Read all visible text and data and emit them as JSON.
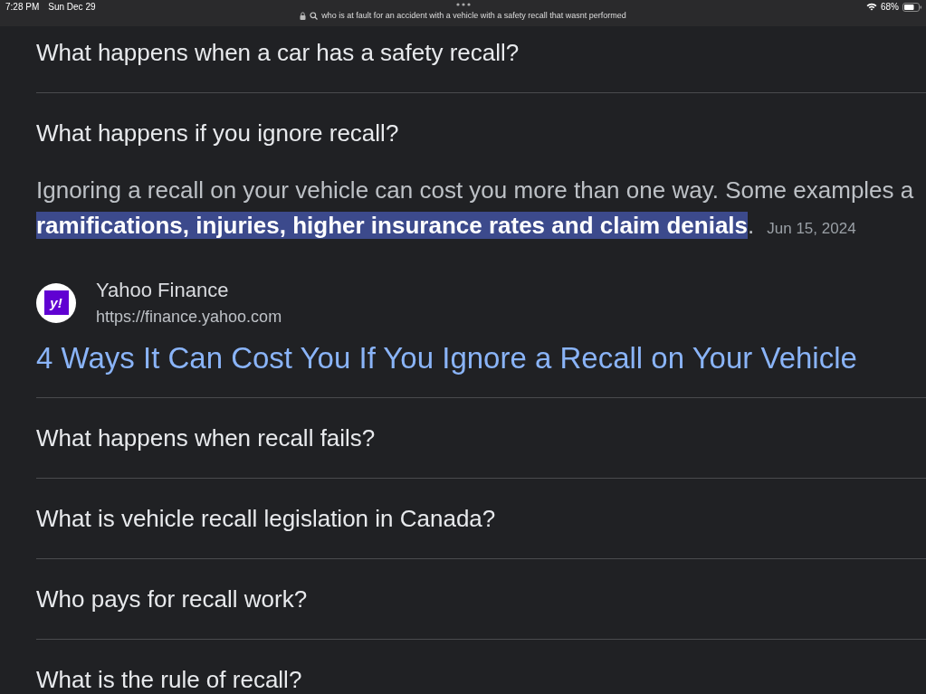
{
  "status_bar": {
    "time": "7:28 PM",
    "date": "Sun Dec 29",
    "url": "who is at fault for an accident with a vehicle with a safety recall that wasnt performed",
    "battery": "68%"
  },
  "questions": [
    {
      "text": "What happens when a car has a safety recall?"
    },
    {
      "text": "What happens if you ignore recall?",
      "answer": {
        "lines": [
          "Ignoring a recall on your vehicle can cost you more than one way. Some examples a",
          "**ramifications, injuries, higher insurance rates and claim denials**."
        ],
        "date": "Jun 15, 2024",
        "source": {
          "logo_text": "y!",
          "name": "Yahoo Finance",
          "url": "https://finance.yahoo.com"
        },
        "title": "4 Ways It Can Cost You If You Ignore a Recall on Your Vehicle"
      }
    },
    {
      "text": "What happens when recall fails?"
    },
    {
      "text": "What is vehicle recall legislation in Canada?"
    },
    {
      "text": "Who pays for recall work?"
    },
    {
      "text": "What is the rule of recall?"
    }
  ]
}
